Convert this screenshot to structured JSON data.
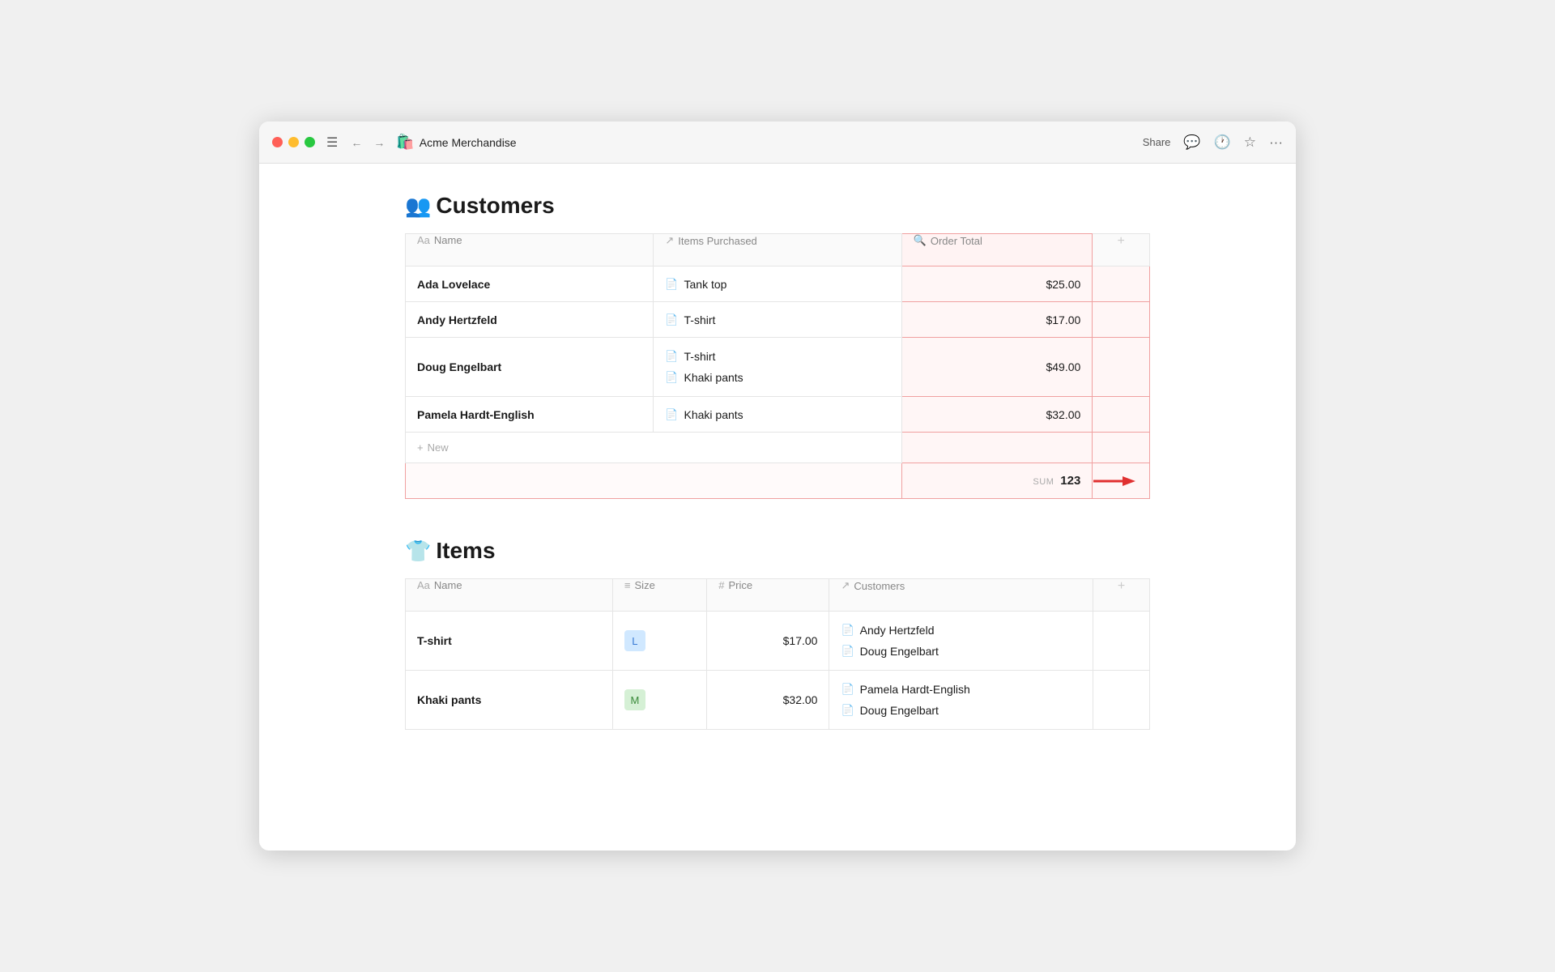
{
  "window": {
    "title": "Acme Merchandise",
    "app_icon": "🛍️"
  },
  "titlebar": {
    "share_label": "Share",
    "menu_icon": "☰",
    "back_icon": "←",
    "forward_icon": "→"
  },
  "customers_section": {
    "emoji": "👥",
    "title": "Customers",
    "columns": {
      "name": "Name",
      "items_purchased": "Items Purchased",
      "order_total": "Order Total"
    },
    "rows": [
      {
        "name": "Ada Lovelace",
        "items": [
          {
            "label": "Tank top"
          }
        ],
        "order_total": "$25.00"
      },
      {
        "name": "Andy Hertzfeld",
        "items": [
          {
            "label": "T-shirt"
          }
        ],
        "order_total": "$17.00"
      },
      {
        "name": "Doug Engelbart",
        "items": [
          {
            "label": "T-shirt"
          },
          {
            "label": "Khaki pants"
          }
        ],
        "order_total": "$49.00"
      },
      {
        "name": "Pamela Hardt-English",
        "items": [
          {
            "label": "Khaki pants"
          }
        ],
        "order_total": "$32.00"
      }
    ],
    "new_label": "New",
    "sum_label": "SUM",
    "sum_value": "123"
  },
  "items_section": {
    "emoji": "👕",
    "title": "Items",
    "columns": {
      "name": "Name",
      "size": "Size",
      "price": "Price",
      "customers": "Customers"
    },
    "rows": [
      {
        "name": "T-shirt",
        "size": "L",
        "size_class": "L",
        "price": "$17.00",
        "customers": [
          {
            "label": "Andy Hertzfeld"
          },
          {
            "label": "Doug Engelbart"
          }
        ]
      },
      {
        "name": "Khaki pants",
        "size": "M",
        "size_class": "M",
        "price": "$32.00",
        "customers": [
          {
            "label": "Pamela Hardt-English"
          },
          {
            "label": "Doug Engelbart"
          }
        ]
      }
    ]
  }
}
